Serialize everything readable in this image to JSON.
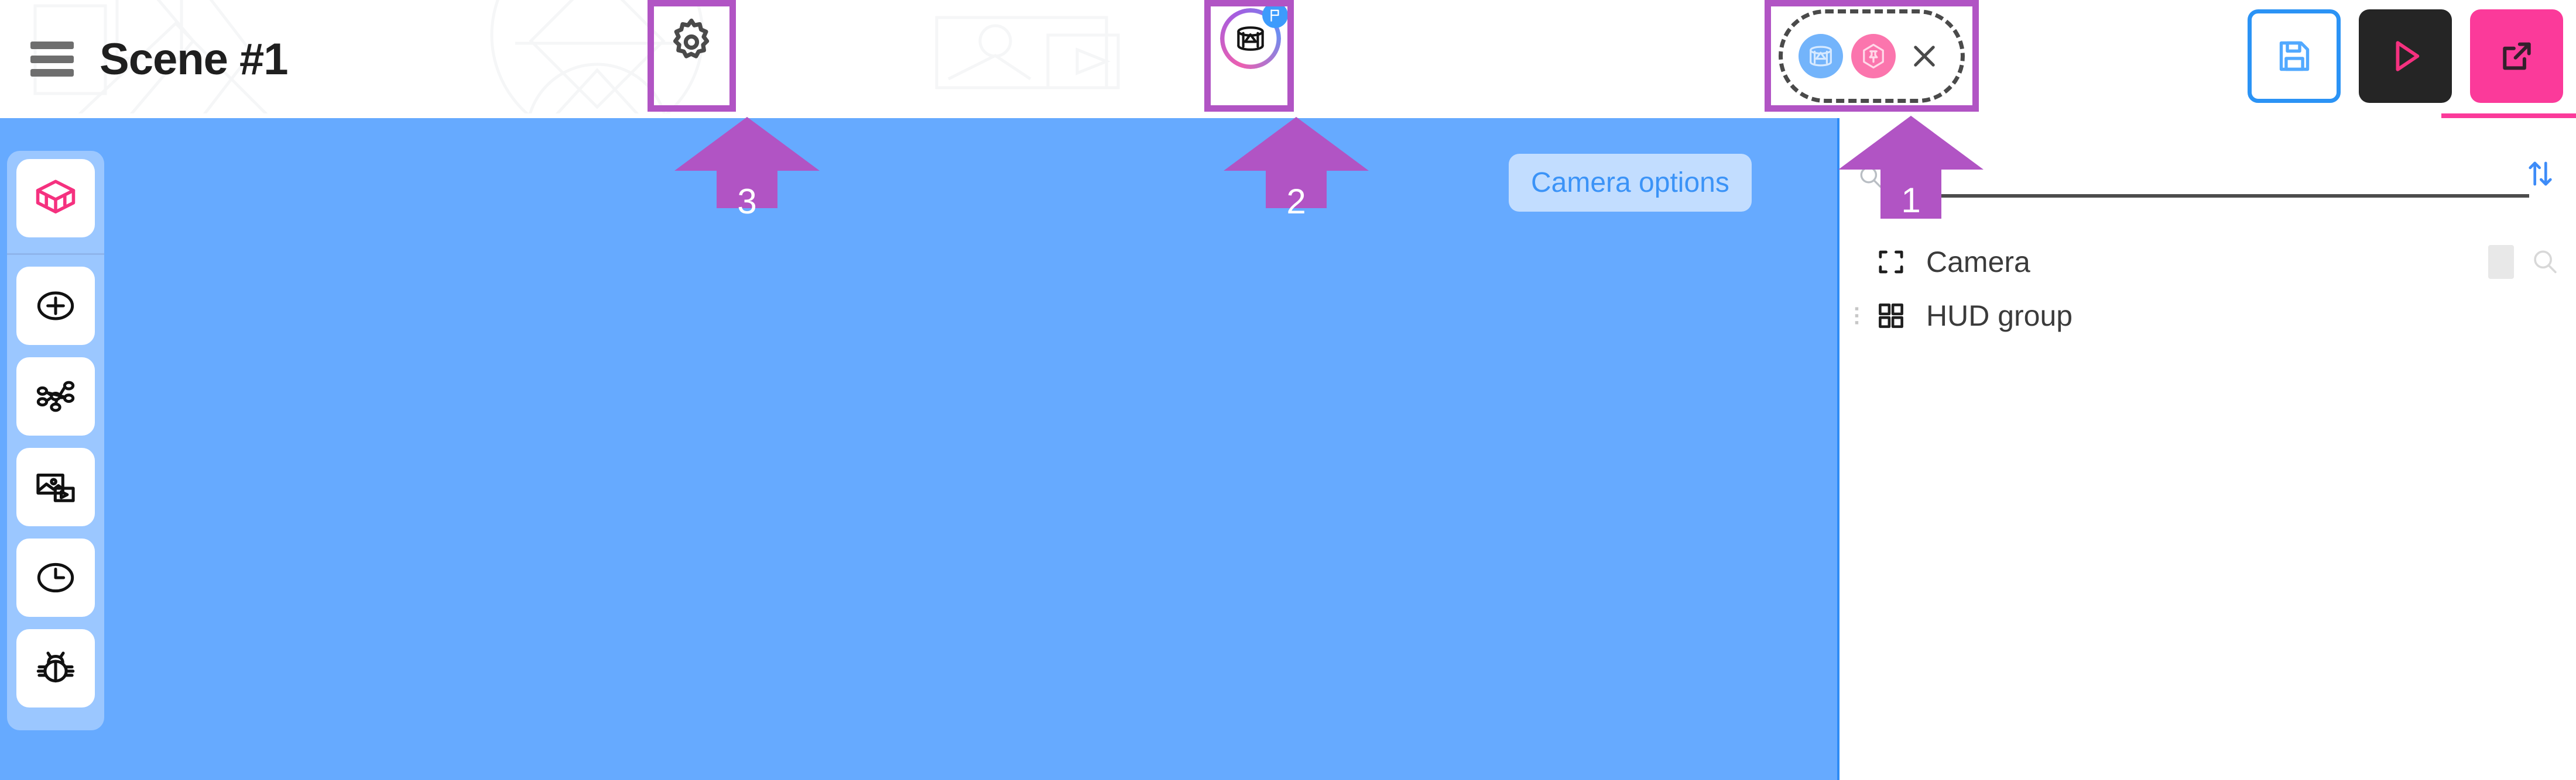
{
  "window": {
    "title": "Scene #1"
  },
  "header": {
    "menu_icon": "hamburger-menu-icon",
    "title": "Scene #1",
    "settings_button": {
      "icon": "gear-icon",
      "label": "Settings"
    },
    "panorama_button": {
      "icon": "panorama-360-icon",
      "badge_icon": "flag-icon",
      "label": "Panorama"
    },
    "selection_group": {
      "panorama_icon": "panorama-360-icon",
      "pin_icon": "hexagon-pin-icon",
      "close_icon": "close-x-icon"
    },
    "actions": [
      {
        "name": "save-button",
        "icon": "floppy-disk-icon",
        "label": "Save"
      },
      {
        "name": "play-button",
        "icon": "play-triangle-icon",
        "label": "Play"
      },
      {
        "name": "share-button",
        "icon": "external-link-icon",
        "label": "Open"
      }
    ]
  },
  "toolbar": {
    "items": [
      {
        "name": "sidebar-item-objects",
        "icon": "3d-box-icon",
        "label": "Objects",
        "active": true
      },
      {
        "name": "sidebar-item-add",
        "icon": "plus-circle-icon",
        "label": "Add"
      },
      {
        "name": "sidebar-item-nodes",
        "icon": "node-graph-icon",
        "label": "Nodes"
      },
      {
        "name": "sidebar-item-media",
        "icon": "media-image-icon",
        "label": "Media"
      },
      {
        "name": "sidebar-item-timeline",
        "icon": "clock-icon",
        "label": "Timeline"
      },
      {
        "name": "sidebar-item-debug",
        "icon": "bug-icon",
        "label": "Debug"
      }
    ]
  },
  "canvas": {
    "camera_options_label": "Camera options",
    "background_color": "#66aaff"
  },
  "panel": {
    "search": {
      "icon": "search-icon",
      "value": "",
      "placeholder": ""
    },
    "sort_icon": "sort-up-down-icon",
    "tree_items": [
      {
        "name": "tree-item-camera",
        "icon": "camera-frame-icon",
        "label": "Camera",
        "has_drag_handle": false,
        "has_visibility_toggle": true,
        "has_search": true
      },
      {
        "name": "tree-item-hud-group",
        "icon": "grid-four-squares-icon",
        "label": "HUD group",
        "has_drag_handle": true,
        "has_visibility_toggle": false,
        "has_search": false
      }
    ]
  },
  "annotations": [
    {
      "name": "annotation-arrow-1",
      "number": "1",
      "target": "selection-group"
    },
    {
      "name": "annotation-arrow-2",
      "number": "2",
      "target": "panorama-button"
    },
    {
      "name": "annotation-arrow-3",
      "number": "3",
      "target": "settings-button"
    }
  ],
  "colors": {
    "annotation_purple": "#b154c4",
    "canvas_blue": "#66aaff",
    "accent_pink": "#fb3a9a",
    "accent_blue": "#2b93f5",
    "panel_white": "#ffffff"
  }
}
